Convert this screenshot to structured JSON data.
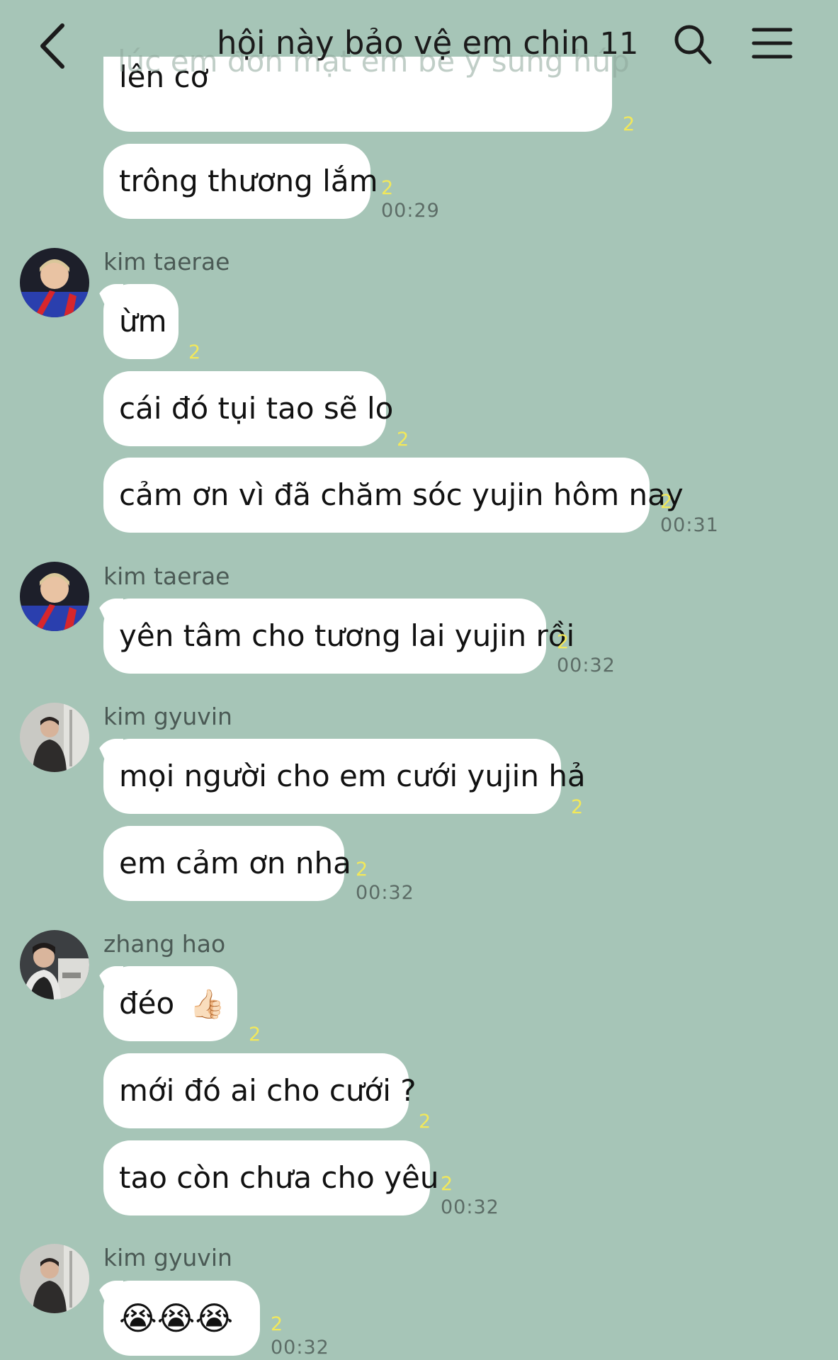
{
  "header": {
    "title": "hội này bảo vệ em chin",
    "member_count": "11"
  },
  "scrolled_text": "lúc em đơn mạt em bé ý sung húp",
  "messages": [
    {
      "text": "lên cơ",
      "read": "2"
    },
    {
      "text": "trông thương lắm",
      "read": "2",
      "time": "00:29"
    },
    {
      "sender": "kim taerae"
    },
    {
      "text": "ừm",
      "read": "2"
    },
    {
      "text": "cái đó tụi tao sẽ lo",
      "read": "2"
    },
    {
      "text": "cảm ơn vì đã chăm sóc yujin hôm nay",
      "read": "2",
      "time": "00:31"
    },
    {
      "sender": "kim taerae"
    },
    {
      "text": "yên tâm cho tương lai yujin rồi",
      "read": "2",
      "time": "00:32"
    },
    {
      "sender": "kim gyuvin"
    },
    {
      "text": "mọi người cho em cưới yujin hả",
      "read": "2"
    },
    {
      "text": "em cảm ơn nha",
      "read": "2",
      "time": "00:32"
    },
    {
      "sender": "zhang hao"
    },
    {
      "text": "đéo",
      "emoji": "👍🏻",
      "read": "2"
    },
    {
      "text": "mới đó ai cho cưới ?",
      "read": "2"
    },
    {
      "text": "tao còn chưa cho yêu",
      "read": "2",
      "time": "00:32"
    },
    {
      "sender": "kim gyuvin"
    },
    {
      "emoji": "😭😭😭",
      "read": "2",
      "time": "00:32"
    }
  ],
  "colors": {
    "background": "#a6c5b7",
    "bubble": "#ffffff",
    "read_counter": "#f2e85a"
  }
}
